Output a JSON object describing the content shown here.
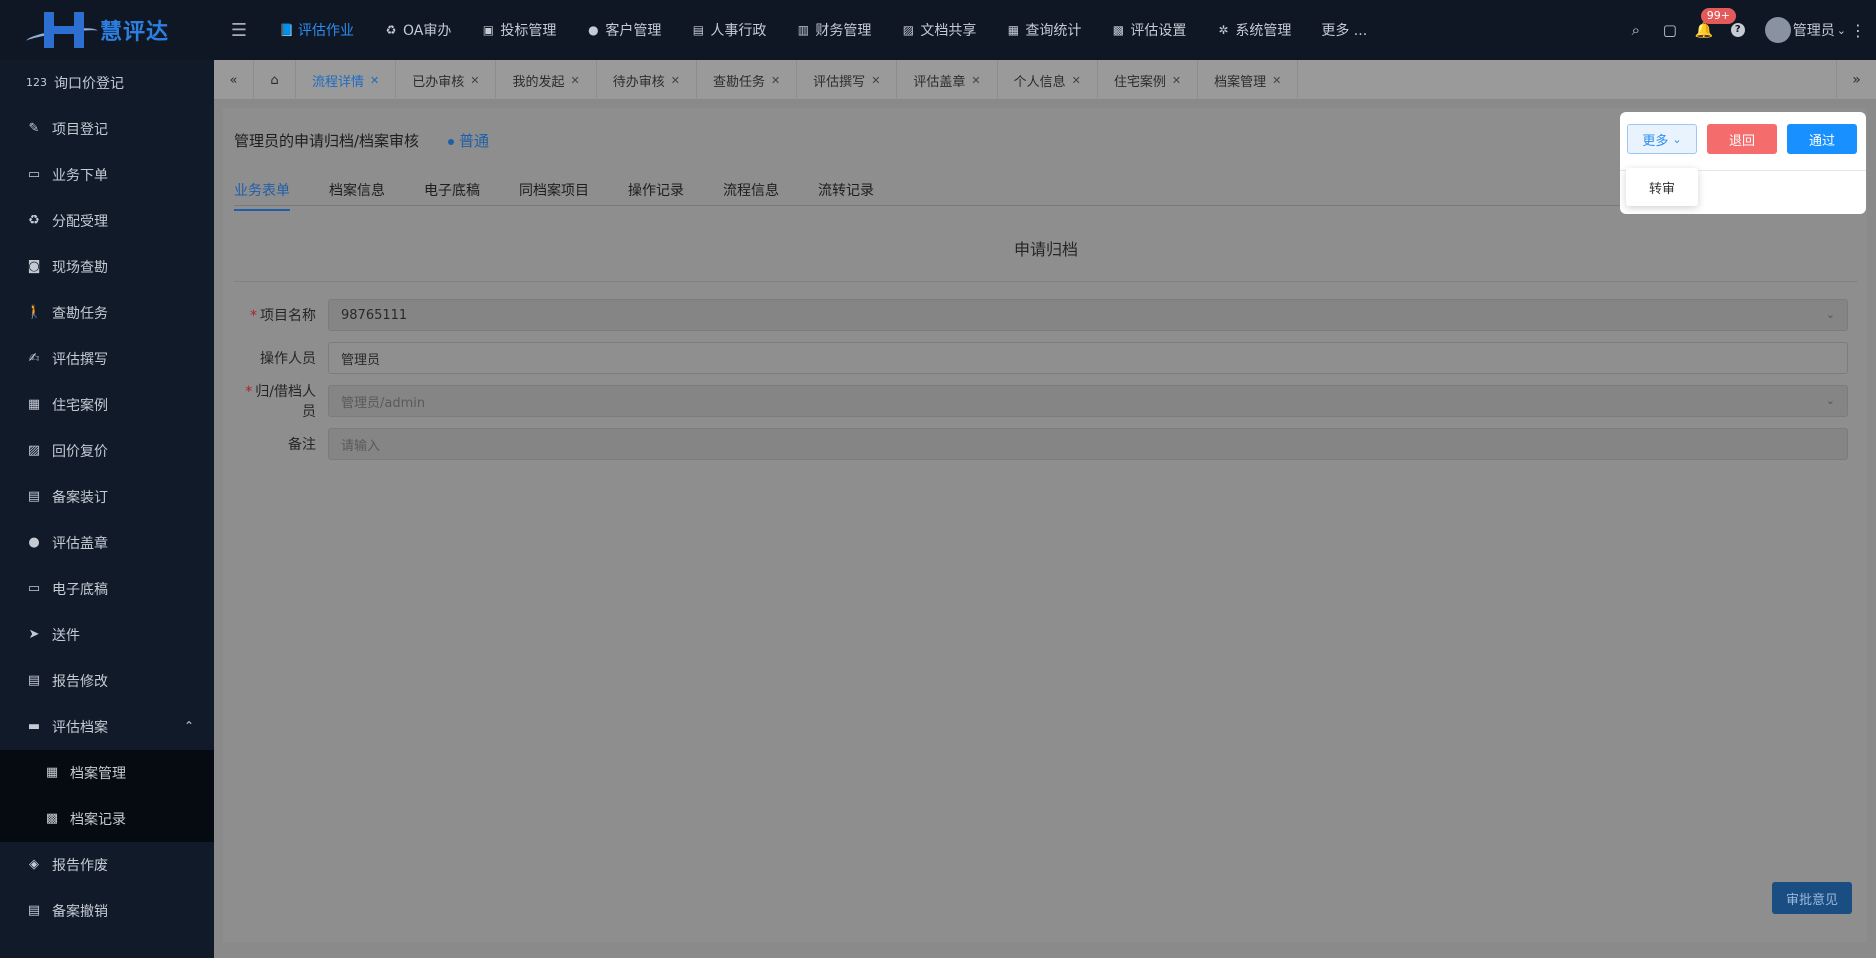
{
  "logo": {
    "text": "慧评达"
  },
  "topnav": [
    {
      "label": "评估作业",
      "icon": "📘",
      "active": true
    },
    {
      "label": "OA审办",
      "icon": "♻"
    },
    {
      "label": "投标管理",
      "icon": "▣"
    },
    {
      "label": "客户管理",
      "icon": "●"
    },
    {
      "label": "人事行政",
      "icon": "▤"
    },
    {
      "label": "财务管理",
      "icon": "▥"
    },
    {
      "label": "文档共享",
      "icon": "▨"
    },
    {
      "label": "查询统计",
      "icon": "▦"
    },
    {
      "label": "评估设置",
      "icon": "▩"
    },
    {
      "label": "系统管理",
      "icon": "✲"
    },
    {
      "label": "更多 ...",
      "icon": ""
    }
  ],
  "topright": {
    "badge": "99+",
    "user": "管理员"
  },
  "sidebar": [
    {
      "label": "询口价登记",
      "icon": "123"
    },
    {
      "label": "项目登记",
      "icon": "✎"
    },
    {
      "label": "业务下单",
      "icon": "▭"
    },
    {
      "label": "分配受理",
      "icon": "♻"
    },
    {
      "label": "现场查勘",
      "icon": "◙"
    },
    {
      "label": "查勘任务",
      "icon": "🚶"
    },
    {
      "label": "评估撰写",
      "icon": "✍"
    },
    {
      "label": "住宅案例",
      "icon": "▦"
    },
    {
      "label": "回价复价",
      "icon": "▨"
    },
    {
      "label": "备案装订",
      "icon": "▤"
    },
    {
      "label": "评估盖章",
      "icon": "●"
    },
    {
      "label": "电子底稿",
      "icon": "▭"
    },
    {
      "label": "送件",
      "icon": "➤"
    },
    {
      "label": "报告修改",
      "icon": "▤"
    },
    {
      "label": "评估档案",
      "icon": "▬",
      "expanded": true
    },
    {
      "label": "档案管理",
      "icon": "▦",
      "sub": true
    },
    {
      "label": "档案记录",
      "icon": "▩",
      "sub": true
    },
    {
      "label": "报告作废",
      "icon": "◈"
    },
    {
      "label": "备案撤销",
      "icon": "▤"
    }
  ],
  "tabs": [
    {
      "label": "流程详情",
      "active": true
    },
    {
      "label": "已办审核"
    },
    {
      "label": "我的发起"
    },
    {
      "label": "待办审核"
    },
    {
      "label": "查勘任务"
    },
    {
      "label": "评估撰写"
    },
    {
      "label": "评估盖章"
    },
    {
      "label": "个人信息"
    },
    {
      "label": "住宅案例"
    },
    {
      "label": "档案管理"
    }
  ],
  "panel": {
    "title": "管理员的申请归档/档案审核",
    "tag": "普通",
    "subtabs": [
      "业务表单",
      "档案信息",
      "电子底稿",
      "同档案项目",
      "操作记录",
      "流程信息",
      "流转记录"
    ],
    "active_subtab": 0
  },
  "form": {
    "title": "申请归档",
    "fields": [
      {
        "label": "项目名称",
        "required": true,
        "value": "98765111",
        "select": true,
        "placeholder": false
      },
      {
        "label": "操作人员",
        "required": false,
        "value": "管理员",
        "select": false,
        "placeholder": false,
        "white": true
      },
      {
        "label": "归/借档人员",
        "required": true,
        "value": "管理员/admin",
        "select": true,
        "placeholder": true
      },
      {
        "label": "备注",
        "required": false,
        "value": "请输入",
        "select": false,
        "placeholder": true
      }
    ],
    "approve_label": "审批意见"
  },
  "actions": {
    "more": "更多",
    "back": "退回",
    "pass": "通过",
    "dropdown": [
      "转审"
    ]
  }
}
